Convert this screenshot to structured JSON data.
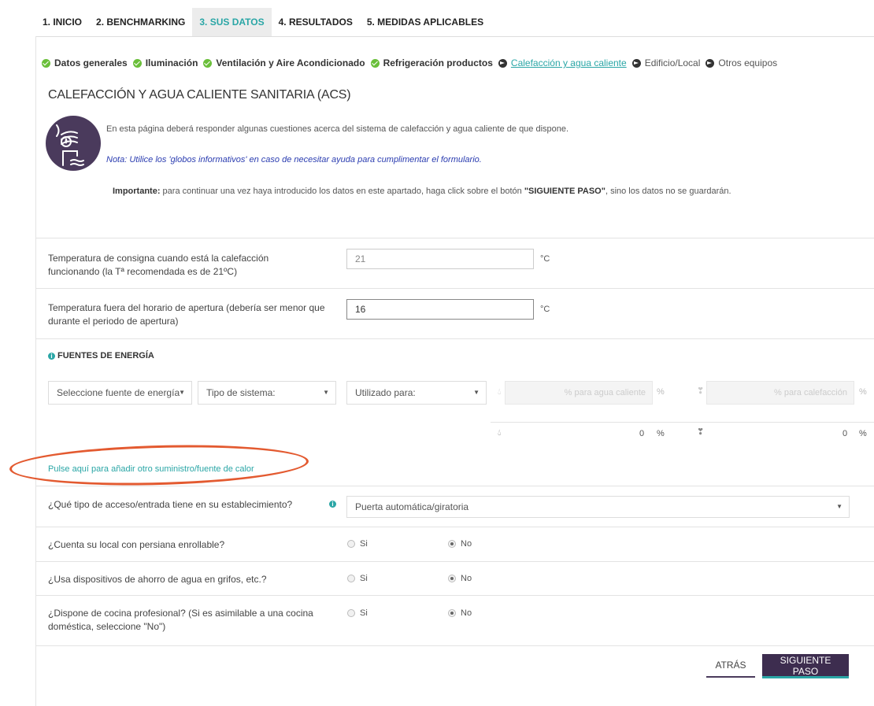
{
  "tabs": [
    {
      "label": "1. INICIO"
    },
    {
      "label": "2. BENCHMARKING"
    },
    {
      "label": "3. SUS DATOS"
    },
    {
      "label": "4. RESULTADOS"
    },
    {
      "label": "5. MEDIDAS APLICABLES"
    }
  ],
  "steps": [
    {
      "label": "Datos generales",
      "state": "done"
    },
    {
      "label": "Iluminación",
      "state": "done"
    },
    {
      "label": "Ventilación y Aire Acondicionado",
      "state": "done"
    },
    {
      "label": "Refrigeración productos",
      "state": "done"
    },
    {
      "label": "Calefacción y agua caliente",
      "state": "current"
    },
    {
      "label": "Edificio/Local",
      "state": "todo"
    },
    {
      "label": "Otros equipos",
      "state": "todo"
    }
  ],
  "page": {
    "title": "CALEFACCIÓN Y AGUA CALIENTE SANITARIA (ACS)",
    "intro": "En esta página deberá responder algunas cuestiones acerca del sistema de calefacción y agua caliente de que dispone.",
    "note": "Nota: Utilice los 'globos informativos' en caso de necesitar ayuda para cumplimentar el formulario.",
    "important_label": "Importante:",
    "important_text": " para continuar una vez haya introducido los datos en este apartado, haga click sobre el botón ",
    "important_button": "\"SIGUIENTE PASO\"",
    "important_end": ", sino los datos no se guardarán."
  },
  "temps": {
    "setpoint_label": "Temperatura de consigna cuando está la calefacción funcionando (la Tª recomendada es de 21ºC)",
    "setpoint_value": "21",
    "off_label": "Temperatura fuera del horario de apertura (debería ser menor que durante el periodo de apertura)",
    "off_value": "16",
    "unit": "°C"
  },
  "energy": {
    "section_title": "FUENTES DE ENERGÍA",
    "source_placeholder": "Seleccione fuente de energía",
    "system_placeholder": "Tipo de sistema:",
    "use_placeholder": "Utilizado para:",
    "pct_water_placeholder": "% para agua caliente",
    "pct_heating_placeholder": "% para calefacción",
    "pct_sign": "%",
    "total_water": "0",
    "total_heating": "0",
    "add_link": "Pulse aquí para añadir otro suministro/fuente de calor"
  },
  "questions": {
    "access_label": "¿Qué tipo de acceso/entrada tiene en su establecimiento?",
    "access_value": "Puerta automática/giratoria",
    "yes": "Si",
    "no": "No",
    "items": [
      {
        "label": "¿Cuenta su local con persiana enrollable?",
        "answer": "No"
      },
      {
        "label": "¿Usa dispositivos de ahorro de agua en grifos, etc.?",
        "answer": "No"
      },
      {
        "label": "¿Dispone de cocina profesional? (Si es asimilable a una cocina doméstica, seleccione \"No\")",
        "answer": "No"
      }
    ]
  },
  "buttons": {
    "back": "ATRÁS",
    "next": "SIGUIENTE PASO"
  },
  "colors": {
    "accent": "#2aa6a6",
    "primary": "#3d2d4f",
    "ok": "#6abf3a",
    "highlight": "#e35a30"
  }
}
